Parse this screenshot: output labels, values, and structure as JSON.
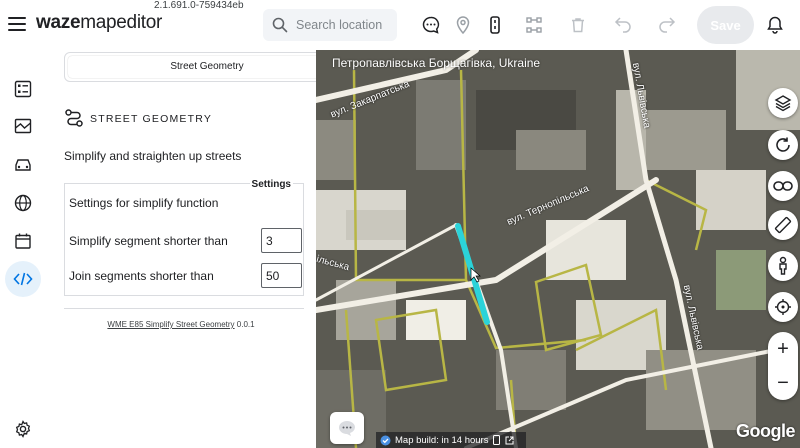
{
  "app": {
    "version": "2.1.691.0-759434eb",
    "logo_bold": "waze",
    "logo_rest": "mapeditor"
  },
  "search": {
    "placeholder": "Search location"
  },
  "toolbar": {
    "icons": [
      "chat-icon",
      "place-icon",
      "segment-icon",
      "nodes-icon",
      "delete-icon",
      "undo-icon",
      "redo-icon",
      "bell-icon"
    ],
    "save_label": "Save"
  },
  "rail": {
    "items": [
      "checklist-icon",
      "map-edit-icon",
      "car-icon",
      "globe-icon",
      "calendar-icon",
      "code-icon",
      "settings-icon"
    ],
    "active": "code-icon"
  },
  "panel": {
    "tab_label": "Street Geometry",
    "section_title": "STREET GEOMETRY",
    "description": "Simplify and straighten up streets",
    "settings_header": "Settings",
    "settings_caption": "Settings for simplify function",
    "simplify_label": "Simplify segment shorter than",
    "simplify_value": "3",
    "join_label": "Join segments shorter than",
    "join_value": "50",
    "footer_link": "WME E85 Simplify Street Geometry",
    "footer_version": " 0.0.1"
  },
  "map": {
    "location_title": "Петропавлівська Борщагівка, Ukraine",
    "street_labels": [
      "вул. Закарпатська",
      "вул. Львівська",
      "вул. Тернопільська",
      "ільська",
      "вул. Львівська"
    ],
    "build_text": "Map build: in 14 hours",
    "attribution": "Google",
    "controls": [
      "layers-icon",
      "refresh-icon",
      "link-icon",
      "ruler-icon",
      "street-view-icon",
      "locate-icon"
    ],
    "zoom_in": "+",
    "zoom_out": "−",
    "selected_segment_color": "#2bd3d9",
    "road_color": "#f2efe6",
    "block_outline_color": "#b8b645"
  }
}
